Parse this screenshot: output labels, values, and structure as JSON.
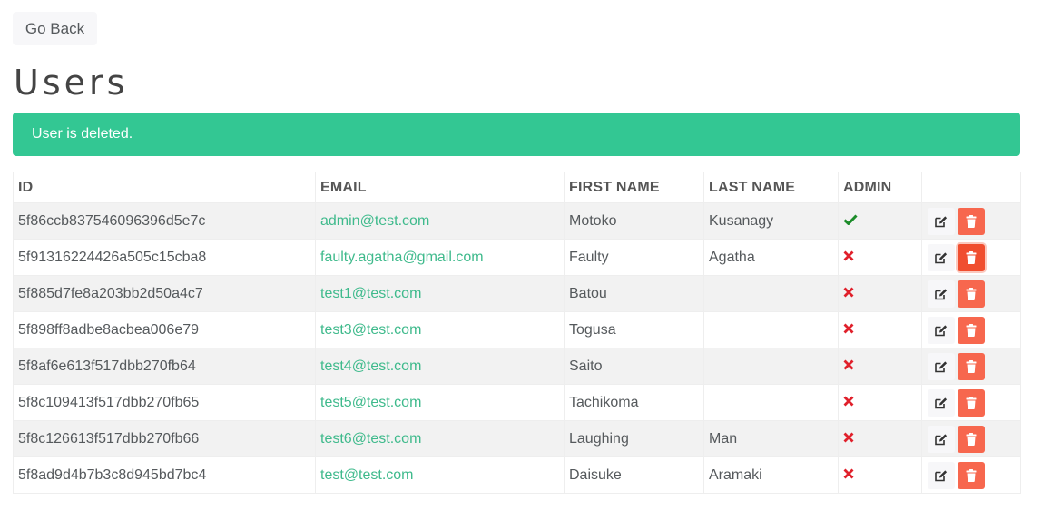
{
  "go_back_label": "Go Back",
  "page_title": "Users",
  "alert": {
    "message": "User is deleted.",
    "color": "#33c793"
  },
  "table": {
    "headers": {
      "id": "ID",
      "email": "EMAIL",
      "first_name": "FIRST NAME",
      "last_name": "LAST NAME",
      "admin": "ADMIN",
      "actions": ""
    },
    "rows": [
      {
        "id": "5f86ccb837546096396d5e7c",
        "email": "admin@test.com",
        "first_name": "Motoko",
        "last_name": "Kusanagy",
        "admin": true
      },
      {
        "id": "5f91316224426a505c15cba8",
        "email": "faulty.agatha@gmail.com",
        "first_name": "Faulty",
        "last_name": "Agatha",
        "admin": false
      },
      {
        "id": "5f885d7fe8a203bb2d50a4c7",
        "email": "test1@test.com",
        "first_name": "Batou",
        "last_name": "",
        "admin": false
      },
      {
        "id": "5f898ff8adbe8acbea006e79",
        "email": "test3@test.com",
        "first_name": "Togusa",
        "last_name": "",
        "admin": false
      },
      {
        "id": "5f8af6e613f517dbb270fb64",
        "email": "test4@test.com",
        "first_name": "Saito",
        "last_name": "",
        "admin": false
      },
      {
        "id": "5f8c109413f517dbb270fb65",
        "email": "test5@test.com",
        "first_name": "Tachikoma",
        "last_name": "",
        "admin": false
      },
      {
        "id": "5f8c126613f517dbb270fb66",
        "email": "test6@test.com",
        "first_name": "Laughing",
        "last_name": "Man",
        "admin": false
      },
      {
        "id": "5f8ad9d4b7b3c8d945bd7bc4",
        "email": "test@test.com",
        "first_name": "Daisuke",
        "last_name": "Aramaki",
        "admin": false
      }
    ]
  },
  "icons": {
    "admin_true": "check-icon",
    "admin_false": "times-icon",
    "edit": "edit-icon",
    "delete": "trash-icon"
  },
  "colors": {
    "link": "#3fba8c",
    "admin_true": "#1c8c2a",
    "admin_false": "#e0202b",
    "delete_button": "#f7674e"
  }
}
